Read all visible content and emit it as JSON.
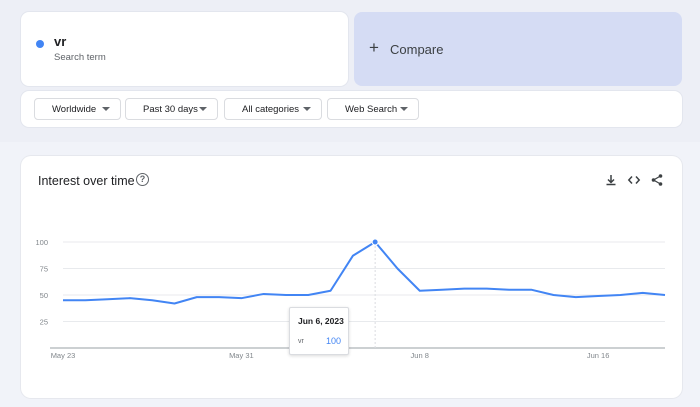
{
  "search_term": {
    "name": "vr",
    "subtitle": "Search term",
    "color": "#4285f4"
  },
  "compare": {
    "icon": "plus-icon",
    "label": "Compare"
  },
  "filters": [
    {
      "label": "Worldwide"
    },
    {
      "label": "Past 30 days"
    },
    {
      "label": "All categories"
    },
    {
      "label": "Web Search"
    }
  ],
  "chart_card": {
    "title": "Interest over time",
    "help_icon": "help-circle-icon",
    "tools": [
      "download-icon",
      "embed-code-icon",
      "share-icon"
    ]
  },
  "tooltip": {
    "date": "Jun 6, 2023",
    "term": "vr",
    "value": "100"
  },
  "chart_data": {
    "type": "line",
    "x": [
      "May 23",
      "May 24",
      "May 25",
      "May 26",
      "May 27",
      "May 28",
      "May 29",
      "May 30",
      "May 31",
      "Jun 1",
      "Jun 2",
      "Jun 3",
      "Jun 4",
      "Jun 5",
      "Jun 6",
      "Jun 7",
      "Jun 8",
      "Jun 9",
      "Jun 10",
      "Jun 11",
      "Jun 12",
      "Jun 13",
      "Jun 14",
      "Jun 15",
      "Jun 16",
      "Jun 17",
      "Jun 18",
      "Jun 19"
    ],
    "x_tick_labels": [
      "May 23",
      "May 31",
      "Jun 8",
      "Jun 16"
    ],
    "y_tick_labels": [
      "100",
      "75",
      "50",
      "25"
    ],
    "ylim": [
      0,
      100
    ],
    "series": [
      {
        "name": "vr",
        "color": "#4285f4",
        "values": [
          45,
          45,
          46,
          47,
          45,
          42,
          48,
          48,
          47,
          51,
          50,
          50,
          54,
          87,
          100,
          75,
          54,
          55,
          56,
          56,
          55,
          55,
          50,
          48,
          49,
          50,
          52,
          50
        ]
      }
    ],
    "highlight_index": 14,
    "grid": true
  }
}
